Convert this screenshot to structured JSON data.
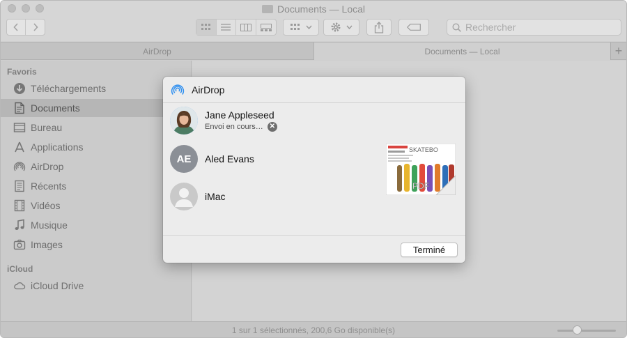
{
  "window": {
    "title": "Documents — Local",
    "search_placeholder": "Rechercher"
  },
  "tabs": [
    {
      "label": "AirDrop"
    },
    {
      "label": "Documents — Local"
    }
  ],
  "sidebar": {
    "favorites_title": "Favoris",
    "items": [
      {
        "label": "Téléchargements",
        "icon": "download-icon"
      },
      {
        "label": "Documents",
        "icon": "document-icon",
        "selected": true
      },
      {
        "label": "Bureau",
        "icon": "desktop-icon"
      },
      {
        "label": "Applications",
        "icon": "applications-icon"
      },
      {
        "label": "AirDrop",
        "icon": "airdrop-icon"
      },
      {
        "label": "Récents",
        "icon": "recents-icon"
      },
      {
        "label": "Vidéos",
        "icon": "film-icon"
      },
      {
        "label": "Musique",
        "icon": "music-icon"
      },
      {
        "label": "Images",
        "icon": "camera-icon"
      }
    ],
    "icloud_title": "iCloud",
    "icloud_items": [
      {
        "label": "iCloud Drive",
        "icon": "cloud-icon"
      }
    ]
  },
  "status_bar": {
    "text": "1 sur 1 sélectionnés, 200,6 Go disponible(s)",
    "zoom_level": 0.33
  },
  "dialog": {
    "title": "AirDrop",
    "people": [
      {
        "name": "Jane Appleseed",
        "status": "Envoi en cours…"
      },
      {
        "name": "Aled Evans",
        "initials": "AE"
      },
      {
        "name": "iMac"
      }
    ],
    "thumbnail": {
      "header_text": "SKATEBO",
      "file_type": "PDF"
    },
    "done_label": "Terminé"
  },
  "colors": {
    "accent": "#3a8ae6",
    "airdrop_blue": "#2e8ff0"
  }
}
